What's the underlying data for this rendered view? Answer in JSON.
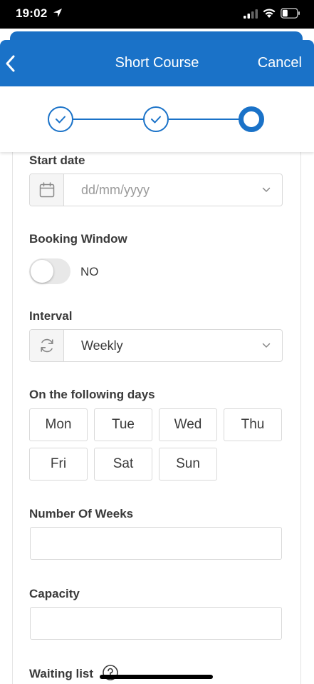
{
  "status_bar": {
    "time": "19:02"
  },
  "header": {
    "title": "Short Course",
    "cancel_label": "Cancel"
  },
  "stepper": {
    "steps": [
      "completed",
      "completed",
      "current"
    ],
    "color": "#1a72c8"
  },
  "form": {
    "start_date": {
      "label": "Start date",
      "placeholder": "dd/mm/yyyy"
    },
    "booking_window": {
      "label": "Booking Window",
      "state": "NO"
    },
    "interval": {
      "label": "Interval",
      "value": "Weekly"
    },
    "days": {
      "label": "On the following days",
      "options": [
        "Mon",
        "Tue",
        "Wed",
        "Thu",
        "Fri",
        "Sat",
        "Sun"
      ]
    },
    "number_of_weeks": {
      "label": "Number Of Weeks",
      "value": ""
    },
    "capacity": {
      "label": "Capacity",
      "value": ""
    },
    "waiting_list": {
      "label": "Waiting list"
    }
  },
  "icons": {
    "back": "chevron-left-icon",
    "calendar": "calendar-icon",
    "dropdown": "chevron-down-icon",
    "refresh": "refresh-icon",
    "help": "question-circle-icon"
  },
  "colors": {
    "brand": "#1a72c8",
    "status_bar": "#000000"
  }
}
